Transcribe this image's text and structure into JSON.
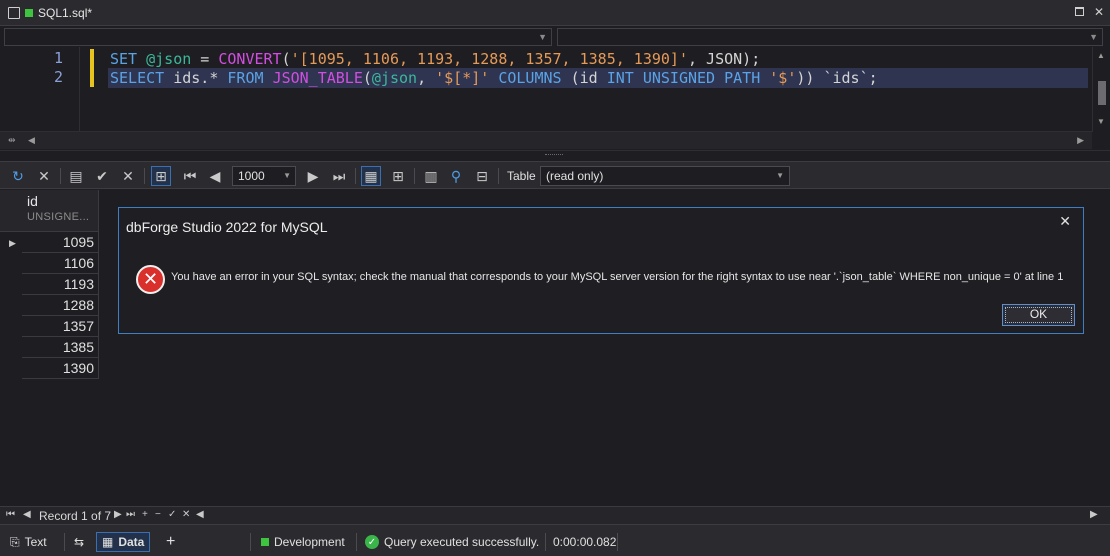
{
  "tab": {
    "title": "SQL1.sql*"
  },
  "editor": {
    "line_numbers": [
      "1",
      "2"
    ],
    "line1": {
      "kw_set": "SET",
      "var": "@json",
      "eq": " = ",
      "fn": "CONVERT",
      "open": "(",
      "str": "'[1095, 1106, 1193, 1288, 1357, 1385, 1390]'",
      "rest": ", JSON);"
    },
    "line2": {
      "kw_select": "SELECT",
      "cols": " ids.* ",
      "kw_from": "FROM",
      "fn": "JSON_TABLE",
      "open": "(",
      "var": "@json",
      "comma": ", ",
      "str": "'$[*]'",
      "kw_columns": "COLUMNS",
      "p1": " (id ",
      "kw_int": "INT UNSIGNED",
      "kw_path": "PATH",
      "str2": "'$'",
      "rest": ")) `ids`;"
    }
  },
  "toolbar": {
    "page_size": "1000",
    "table_label": "Table",
    "table_mode": "(read only)"
  },
  "grid": {
    "column": {
      "name": "id",
      "type": "UNSIGNE..."
    },
    "rows": [
      "1095",
      "1106",
      "1193",
      "1288",
      "1357",
      "1385",
      "1390"
    ]
  },
  "dialog": {
    "title": "dbForge Studio 2022 for MySQL",
    "message": "You have an error in your SQL syntax; check the manual that corresponds to your MySQL server version for the right syntax to use near '.`json_table` WHERE non_unique = 0' at line 1",
    "ok_label": "OK"
  },
  "navigation": {
    "record_text": "Record 1 of 7"
  },
  "statusbar": {
    "text_tab": "Text",
    "data_tab": "Data",
    "add": "+",
    "environment": "Development",
    "status": "Query executed successfully.",
    "elapsed": "0:00:00.082"
  },
  "colors": {
    "accent": "#3d7fc2",
    "error": "#d9302c",
    "success": "#39b54a",
    "env": "#3ec43e"
  }
}
